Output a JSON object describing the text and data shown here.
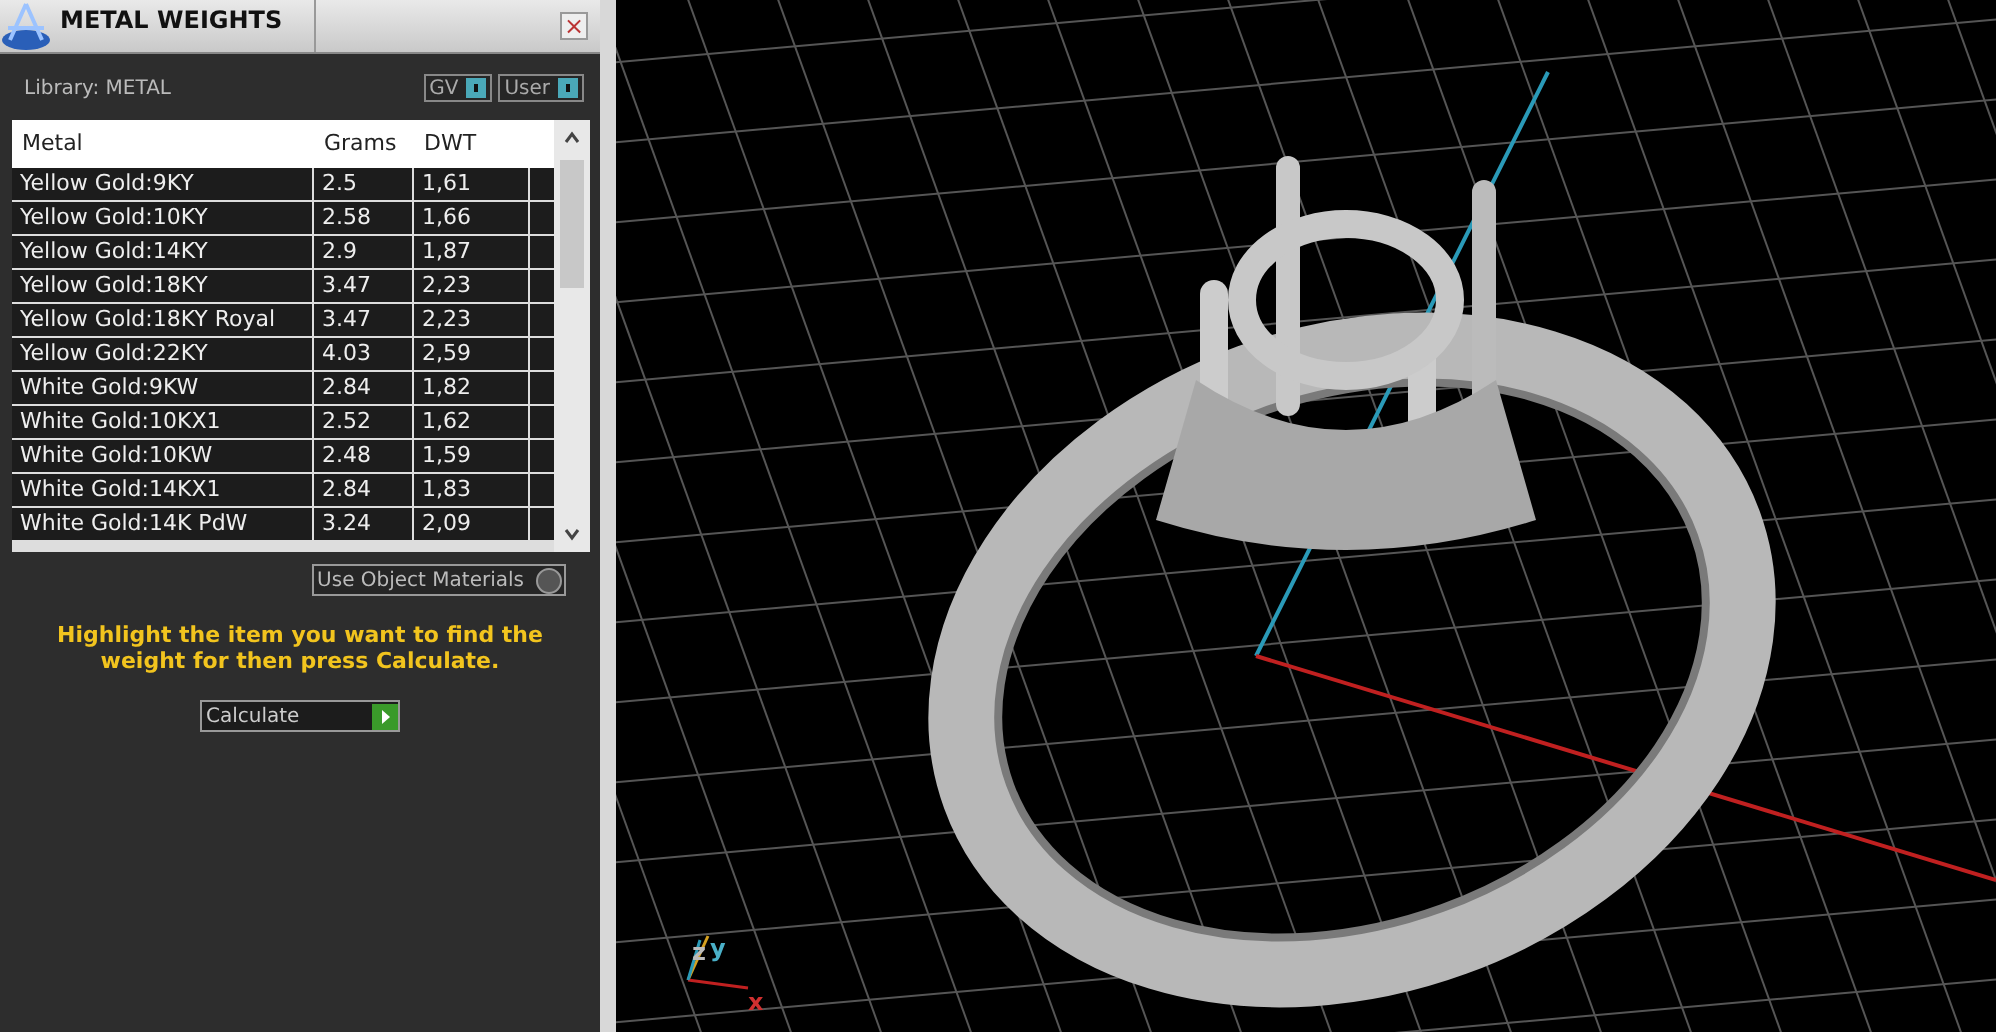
{
  "window": {
    "title": "METAL WEIGHTS",
    "close": "×"
  },
  "library": {
    "label": "Library: METAL"
  },
  "toggles": [
    {
      "label": "GV",
      "on": true
    },
    {
      "label": "User",
      "on": true
    }
  ],
  "table": {
    "columns": [
      "Metal",
      "Grams",
      "DWT"
    ],
    "rows": [
      {
        "metal": "Yellow Gold:9KY",
        "grams": "2.5",
        "dwt": "1,61"
      },
      {
        "metal": "Yellow Gold:10KY",
        "grams": "2.58",
        "dwt": "1,66"
      },
      {
        "metal": "Yellow Gold:14KY",
        "grams": "2.9",
        "dwt": "1,87"
      },
      {
        "metal": "Yellow Gold:18KY",
        "grams": "3.47",
        "dwt": "2,23"
      },
      {
        "metal": "Yellow Gold:18KY Royal",
        "grams": "3.47",
        "dwt": "2,23"
      },
      {
        "metal": "Yellow Gold:22KY",
        "grams": "4.03",
        "dwt": "2,59"
      },
      {
        "metal": "White Gold:9KW",
        "grams": "2.84",
        "dwt": "1,82"
      },
      {
        "metal": "White Gold:10KX1",
        "grams": "2.52",
        "dwt": "1,62"
      },
      {
        "metal": "White Gold:10KW",
        "grams": "2.48",
        "dwt": "1,59"
      },
      {
        "metal": "White Gold:14KX1",
        "grams": "2.84",
        "dwt": "1,83"
      },
      {
        "metal": "White Gold:14K PdW",
        "grams": "3.24",
        "dwt": "2,09"
      }
    ]
  },
  "use_object_materials": {
    "label": "Use Object Materials",
    "on": false
  },
  "hint": "Highlight the item you want to find the weight for then press Calculate.",
  "calculate_button": {
    "label": "Calculate"
  },
  "viewport": {
    "axis_labels": {
      "z": "z",
      "y": "y",
      "x": "x"
    }
  }
}
